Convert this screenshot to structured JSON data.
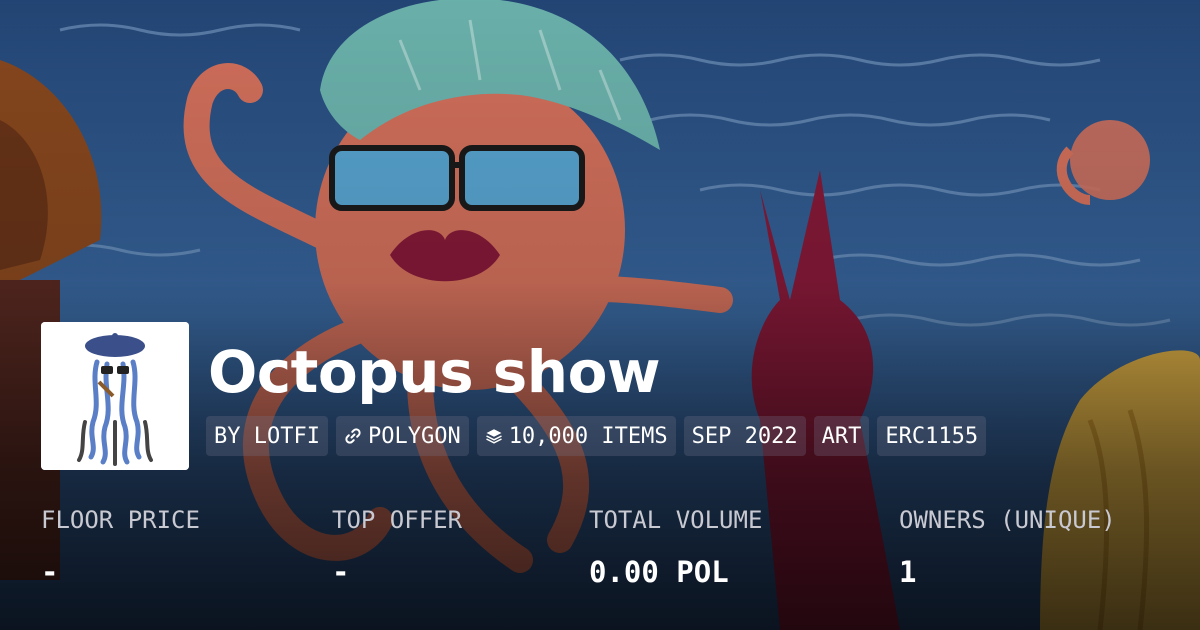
{
  "collection": {
    "name": "Octopus show",
    "tags": [
      {
        "label": "BY LOTFI",
        "icon": ""
      },
      {
        "label": "POLYGON",
        "icon": "link-icon"
      },
      {
        "label": "10,000 ITEMS",
        "icon": "layers-icon"
      },
      {
        "label": "SEP 2022",
        "icon": ""
      },
      {
        "label": "ART",
        "icon": ""
      },
      {
        "label": "ERC1155",
        "icon": ""
      }
    ]
  },
  "stats": [
    {
      "label": "FLOOR PRICE",
      "value": "-"
    },
    {
      "label": "TOP OFFER",
      "value": "-"
    },
    {
      "label": "TOTAL VOLUME",
      "value": "0.00 POL"
    },
    {
      "label": "OWNERS (UNIQUE)",
      "value": "1"
    }
  ],
  "colors": {
    "sea": "#2d5a8e",
    "octopus": "#d8735e",
    "hair": "#6fb8b2",
    "lips": "#8a1a3a"
  }
}
